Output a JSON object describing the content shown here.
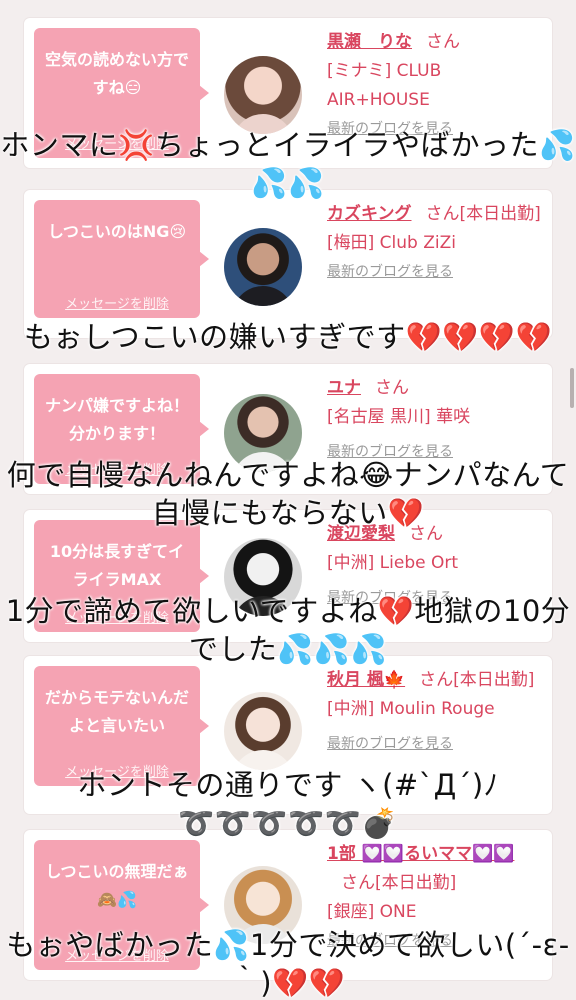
{
  "cards": [
    {
      "message": "空気の読めない方ですね😑",
      "delete_label": "メッセージを削除",
      "name": "黒瀬　りな",
      "san": "さん",
      "shop_lines": [
        "[ミナミ] CLUB",
        "AIR+HOUSE"
      ],
      "blog_link": "最新のブログを見る"
    },
    {
      "message": "しつこいのはNG😢",
      "delete_label": "メッセージを削除",
      "name": "カズキング",
      "san": "さん[本日出勤]",
      "shop_lines": [
        "[梅田] Club ZiZi"
      ],
      "blog_link": "最新のブログを見る"
    },
    {
      "message": "ナンパ嫌ですよね！分かります！",
      "delete_label": "メッセージを削除",
      "name": "ユナ",
      "san": "さん",
      "shop_lines": [
        "[名古屋 黒川] 華咲"
      ],
      "blog_link": "最新のブログを見る"
    },
    {
      "message": "10分は長すぎてイライラMAX",
      "delete_label": "メッセージを削除",
      "name": "渡辺愛梨",
      "san": "さん",
      "shop_lines": [
        "[中洲] Liebe Ort"
      ],
      "blog_link": "最新のブログを見る"
    },
    {
      "message": "だからモテないんだよと言いたい",
      "delete_label": "メッセージを削除",
      "name": "秋月 楓🍁",
      "san": "さん[本日出勤]",
      "shop_lines": [
        "[中洲] Moulin Rouge"
      ],
      "blog_link": "最新のブログを見る"
    },
    {
      "message": "しつこいの無理だぁ🙈💦",
      "delete_label": "メッセージを削除",
      "name": "1部 💟💟るいママ💟💟",
      "san": "さん[本日出勤]",
      "shop_lines": [
        "[銀座] ONE"
      ],
      "blog_link": "最新のブログを見る"
    }
  ],
  "comments": [
    "ホンマに💢ちょっとイライラやばかった💦💦💦",
    "もぉしつこいの嫌いすぎです💔💔💔💔",
    "何で自慢なんねんですよね😂ナンパなんて自慢にもならない💔",
    "1分で諦めて欲しいですよね💔地獄の10分でした💦💦💦",
    "ホントその通りです ヽ(#`Д´)ﾉ ➰➰➰➰➰💣",
    "もぉやばかった💦1分で決めて欲しい(´-ε-｀)💔💔"
  ],
  "colors": {
    "accent": "#d9465f",
    "bubble": "#f5a3b3",
    "background": "#f3eeee"
  }
}
